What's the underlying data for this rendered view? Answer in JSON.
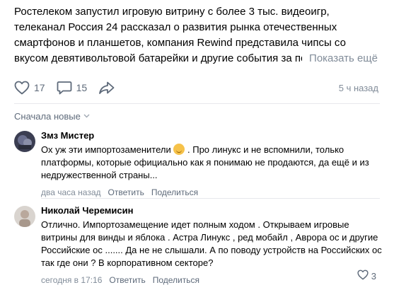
{
  "post": {
    "text": "Ростелеком запустил игровую витрину с более 3 тыс. видеоигр, телеканал Россия 24 рассказал о развития рынка отечественных смартфонов и планшетов, компания Rewind представила чипсы со вкусом девятивольтовой батарейки и другие события за последнюю",
    "show_more": "Показать ещё",
    "likes": "17",
    "comments": "15",
    "time": "5 ч назад"
  },
  "sort": {
    "label": "Сначала новые"
  },
  "comments": [
    {
      "author": "Змз Мистер",
      "text_before_emoji": "Ох уж эти импортозаменители ",
      "text_after_emoji": " . Про линукс и не вспомнили, только платформы, которые официально как я понимаю не продаются, да ещё и из недружественной страны...",
      "time": "два часа назад",
      "reply": "Ответить",
      "share": "Поделиться"
    },
    {
      "author": "Николай Черемисин",
      "text": "Отлично. Импортозамещение идет полным ходом . Открываем игровые витрины для винды и яблока . Астра Линукс , ред мобайл , Аврора ос и другие Российские ос ....... Да не не слышали. А по поводу устройств на Российских ос так где они ? В корпоративном секторе?",
      "time": "сегодня в 17:16",
      "reply": "Ответить",
      "share": "Поделиться",
      "likes": "3"
    }
  ],
  "icons": {
    "like": "heart-icon",
    "comment": "comment-bubble-icon",
    "share": "share-arrow-icon",
    "chevron": "chevron-down-icon"
  },
  "colors": {
    "secondary_text": "#818c99",
    "icon": "#5e6a7a",
    "divider": "#e7e8ec"
  }
}
